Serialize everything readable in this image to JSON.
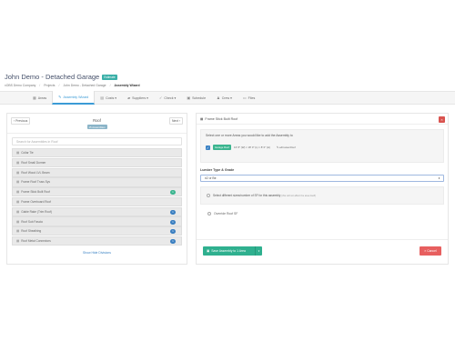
{
  "header": {
    "title": "John Demo - Detached Garage",
    "badge": "Estimate",
    "breadcrumb": [
      "xOBS Demo Company",
      "Projects",
      "John Demo - Detached Garage",
      "Assembly Wizard"
    ]
  },
  "nav": {
    "items": [
      {
        "label": "Areas",
        "icon": "grid-icon"
      },
      {
        "label": "Assembly Wizard",
        "icon": "wand-icon",
        "active": true
      },
      {
        "label": "Costs ▾",
        "icon": "money-icon"
      },
      {
        "label": "Suppliers ▾",
        "icon": "truck-icon"
      },
      {
        "label": "Check ▾",
        "icon": "check-icon"
      },
      {
        "label": "Schedule",
        "icon": "calendar-icon"
      },
      {
        "label": "Crew ▾",
        "icon": "crew-icon"
      },
      {
        "label": "Files",
        "icon": "folder-icon"
      }
    ]
  },
  "left_panel": {
    "prev_label": "‹ Previous",
    "next_label": "Next ›",
    "section_name": "Roof",
    "count_badge": "15 Assemblies",
    "search_placeholder": "Search for Assemblies in Roof",
    "items": [
      {
        "label": "Collar Tie",
        "count": ""
      },
      {
        "label": "Roof Small Dormer",
        "count": ""
      },
      {
        "label": "Roof Wood LVL Beam",
        "count": ""
      },
      {
        "label": "Frame Roof Truss Sys",
        "count": ""
      },
      {
        "label": "Frame Stick Built Roof",
        "count": "1",
        "color": "green"
      },
      {
        "label": "Frame Overboard Roof",
        "count": ""
      },
      {
        "label": "Gable Rake (Trim Roof)",
        "count": "1",
        "color": "blue"
      },
      {
        "label": "Roof Sub Fascia",
        "count": "1",
        "color": "blue"
      },
      {
        "label": "Roof Sheathing",
        "count": "1",
        "color": "blue"
      },
      {
        "label": "Roof Metal Connectors",
        "count": "1",
        "color": "blue"
      }
    ],
    "show_hidden": "Show Hide Divisions"
  },
  "right_panel": {
    "title": "Frame Stick Built Roof",
    "instruction": "Select one or more Areas you would like to add the Assembly to",
    "area": {
      "tag": "Garage Roof",
      "dims": "16' 8\" (W) × 18' 0\" (L) × 8' 0\" (H)",
      "edit": "edit area Roof",
      "checked": true
    },
    "lumber_label": "Lumber Type & Grade",
    "lumber_value": "#2 or Btr.",
    "note": "Select different sizes/number of SF for this assembly",
    "note_dim": "(this will not affect the area itself)",
    "override": "Override Roof SF",
    "save_label": "Save Assembly to 1 Area",
    "cancel_label": "Cancel"
  }
}
